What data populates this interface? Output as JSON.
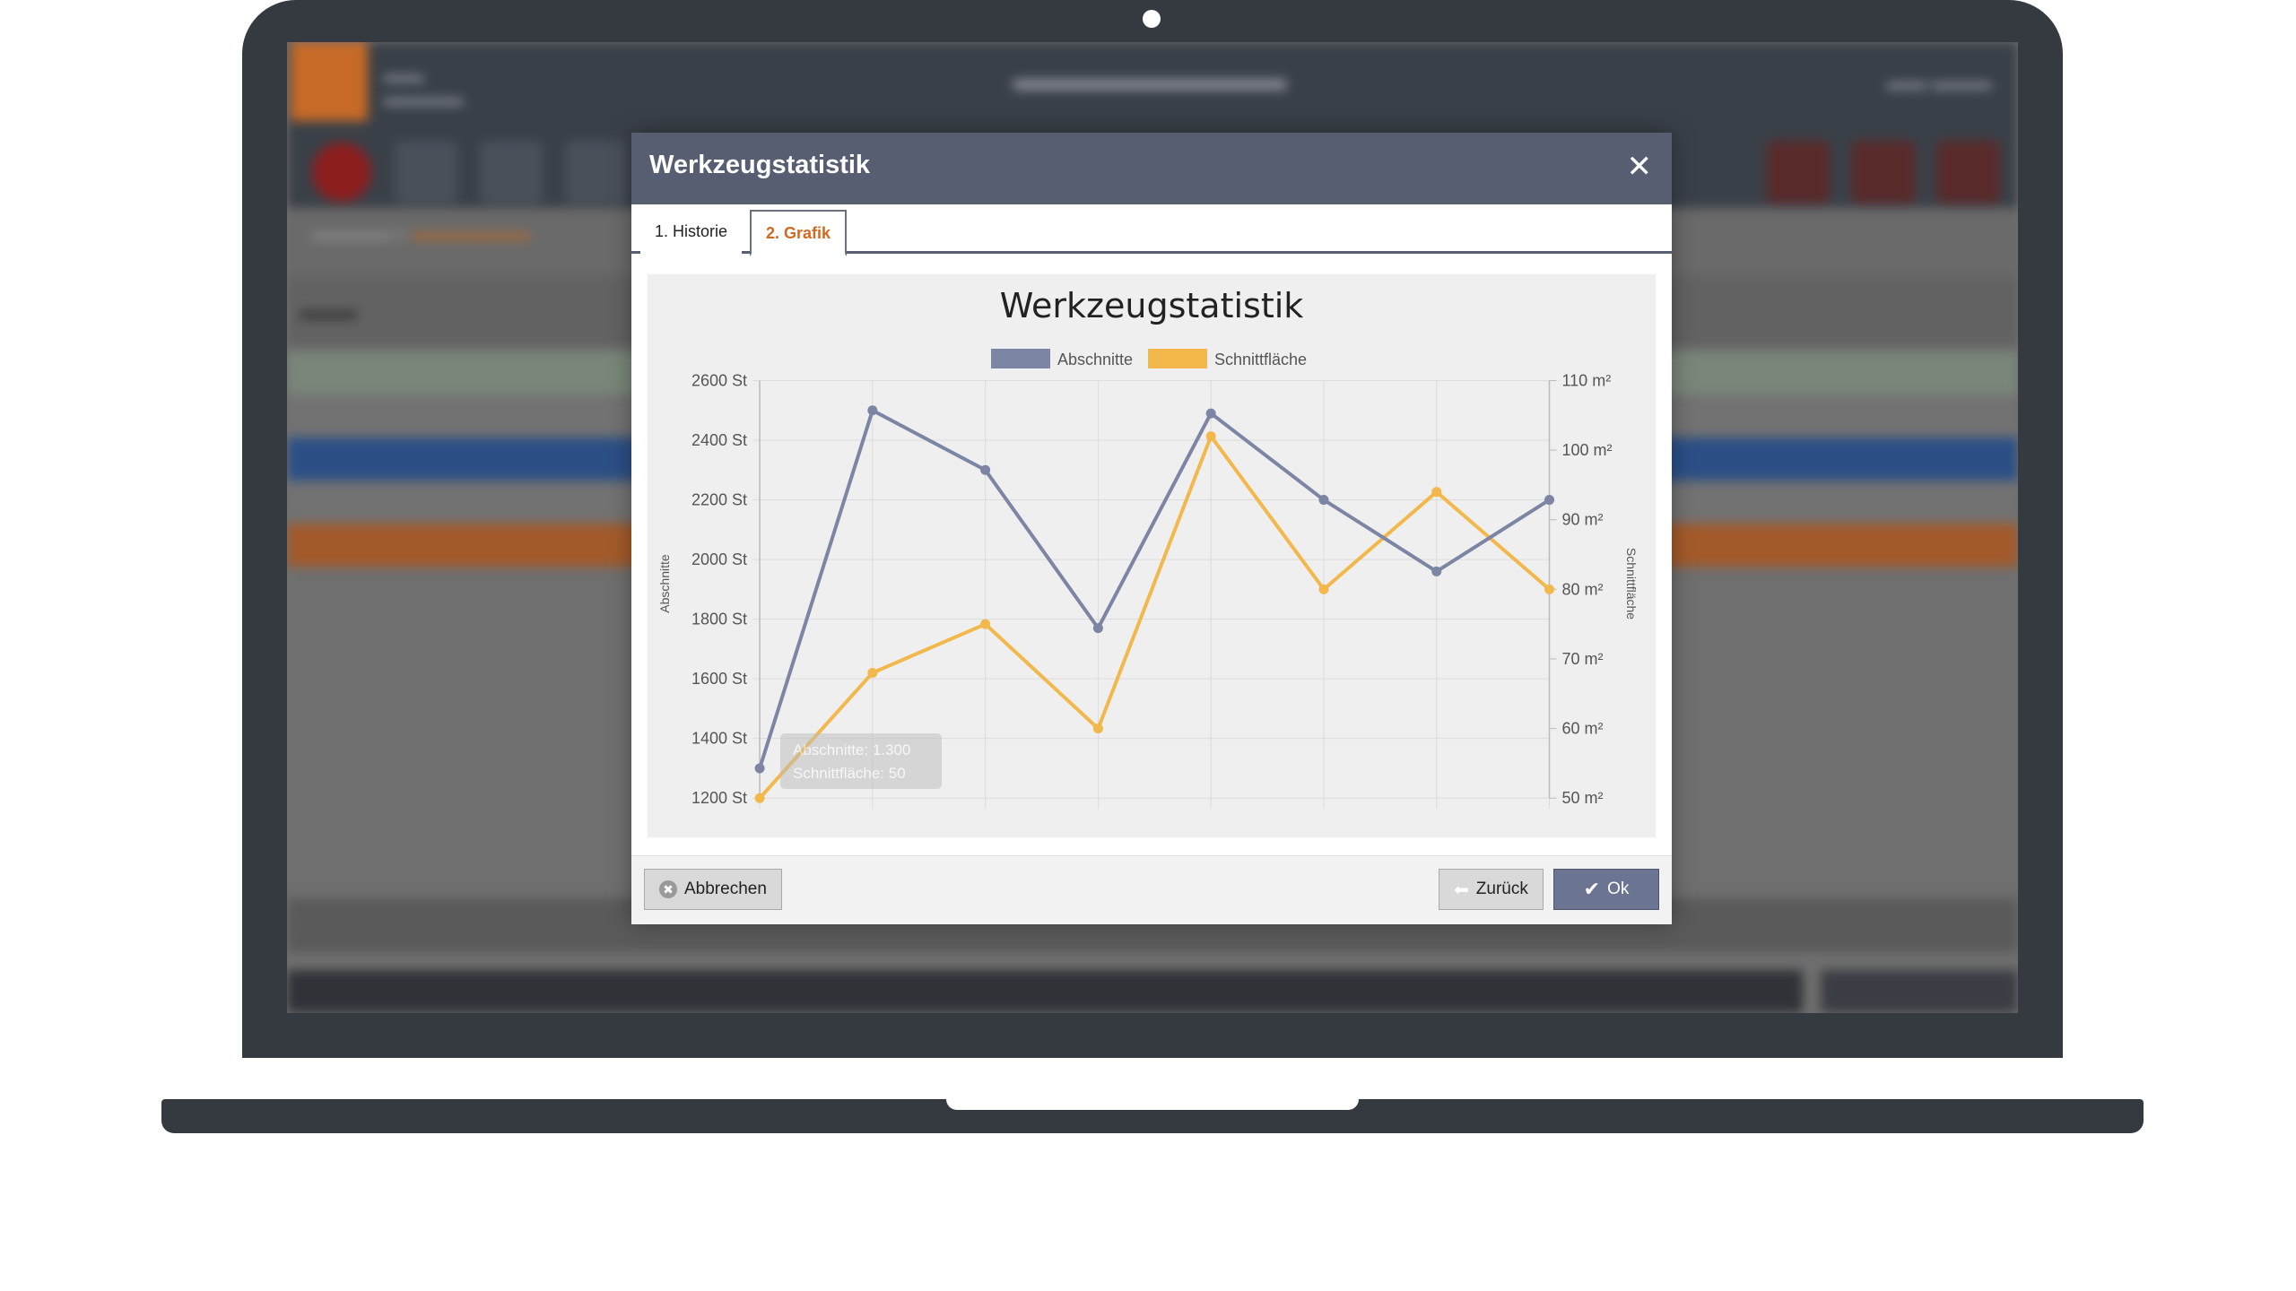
{
  "dialog": {
    "title": "Werkzeugstatistik",
    "close_icon": "close-icon",
    "tabs": [
      {
        "label": "1. Historie",
        "active": false
      },
      {
        "label": "2. Grafik",
        "active": true
      }
    ],
    "footer": {
      "cancel_label": "Abbrechen",
      "back_label": "Zurück",
      "ok_label": "Ok"
    }
  },
  "colors": {
    "header": "#575e72",
    "active_tab_text": "#d2691e",
    "series_abschnitte": "#7c85a3",
    "series_schnittflaeche": "#f2b84b"
  },
  "chart_data": {
    "type": "line",
    "title": "Werkzeugstatistik",
    "legend_position": "top",
    "grid": true,
    "x": [
      1,
      2,
      3,
      4,
      5,
      6,
      7,
      8
    ],
    "y_left": {
      "label": "Abschnitte",
      "range": [
        1200,
        2600
      ],
      "ticks": [
        "1200 St",
        "1400 St",
        "1600 St",
        "1800 St",
        "2000 St",
        "2200 St",
        "2400 St",
        "2600 St"
      ]
    },
    "y_right": {
      "label": "Schnittfläche",
      "range": [
        50,
        110
      ],
      "ticks": [
        "50 m²",
        "60 m²",
        "70 m²",
        "80 m²",
        "90 m²",
        "100 m²",
        "110 m²"
      ]
    },
    "series": [
      {
        "name": "Abschnitte",
        "axis": "left",
        "values": [
          1300,
          2500,
          2300,
          1770,
          2490,
          2200,
          1960,
          2200
        ]
      },
      {
        "name": "Schnittfläche",
        "axis": "right",
        "values": [
          50,
          68,
          75,
          60,
          102,
          80,
          94,
          80
        ]
      }
    ],
    "tooltip": {
      "lines": [
        "Abschnitte: 1.300",
        "Schnittfläche: 50"
      ]
    }
  }
}
